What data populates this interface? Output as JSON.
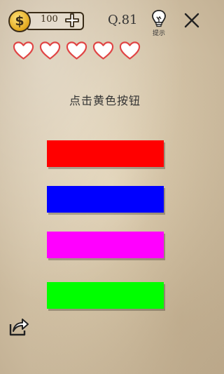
{
  "hud": {
    "coin_symbol": "$",
    "coin_count": "100",
    "level": "Q.81",
    "hint_label": "提示",
    "lives": 5,
    "icons": [
      "coin-icon",
      "plus-icon",
      "lightbulb-icon",
      "close-icon",
      "heart-icon",
      "share-icon"
    ]
  },
  "puzzle": {
    "instruction": "点击黄色按钮",
    "buttons": [
      {
        "color": "#ff0000"
      },
      {
        "color": "#0000ff"
      },
      {
        "color": "#ff00ff"
      },
      {
        "color": "#00ff00"
      }
    ]
  }
}
